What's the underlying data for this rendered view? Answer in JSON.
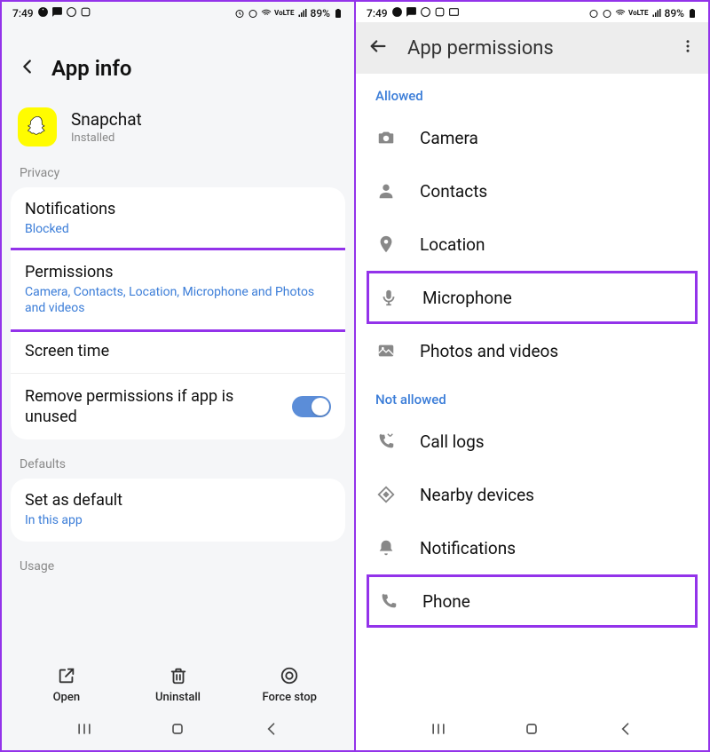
{
  "status": {
    "time": "7:49",
    "battery": "89%"
  },
  "left": {
    "title": "App info",
    "app": {
      "name": "Snapchat",
      "status": "Installed"
    },
    "privacy": {
      "label": "Privacy",
      "notifications": {
        "title": "Notifications",
        "sub": "Blocked"
      },
      "permissions": {
        "title": "Permissions",
        "sub": "Camera, Contacts, Location, Microphone and Photos and videos"
      },
      "screentime": {
        "title": "Screen time"
      },
      "remove": {
        "title": "Remove permissions if app is unused"
      }
    },
    "defaults": {
      "label": "Defaults",
      "setdefault": {
        "title": "Set as default",
        "sub": "In this app"
      }
    },
    "usage": {
      "label": "Usage"
    },
    "actions": {
      "open": "Open",
      "uninstall": "Uninstall",
      "forcestop": "Force stop"
    }
  },
  "right": {
    "title": "App permissions",
    "allowed": {
      "label": "Allowed",
      "items": [
        "Camera",
        "Contacts",
        "Location",
        "Microphone",
        "Photos and videos"
      ]
    },
    "notallowed": {
      "label": "Not allowed",
      "items": [
        "Call logs",
        "Nearby devices",
        "Notifications",
        "Phone"
      ]
    }
  }
}
